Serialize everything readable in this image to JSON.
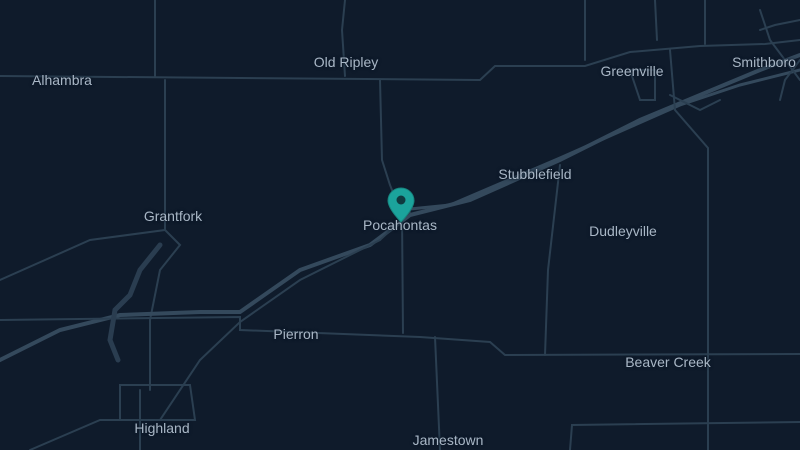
{
  "map": {
    "theme_colors": {
      "background": "#0f1b2b",
      "road": "#2b3f51",
      "road_major": "#34495c",
      "label": "#a9b7c6",
      "marker": "#1ba39c"
    },
    "places": [
      {
        "id": "old-ripley",
        "name": "Old Ripley"
      },
      {
        "id": "alhambra",
        "name": "Alhambra"
      },
      {
        "id": "greenville",
        "name": "Greenville"
      },
      {
        "id": "smithboro",
        "name": "Smithboro"
      },
      {
        "id": "stubblefield",
        "name": "Stubblefield"
      },
      {
        "id": "grantfork",
        "name": "Grantfork"
      },
      {
        "id": "pocahontas",
        "name": "Pocahontas"
      },
      {
        "id": "dudleyville",
        "name": "Dudleyville"
      },
      {
        "id": "pierron",
        "name": "Pierron"
      },
      {
        "id": "beaver-creek",
        "name": "Beaver Creek"
      },
      {
        "id": "highland",
        "name": "Highland"
      },
      {
        "id": "jamestown",
        "name": "Jamestown"
      }
    ],
    "marker": {
      "icon": "map-pin-icon",
      "location": "Pocahontas"
    }
  }
}
